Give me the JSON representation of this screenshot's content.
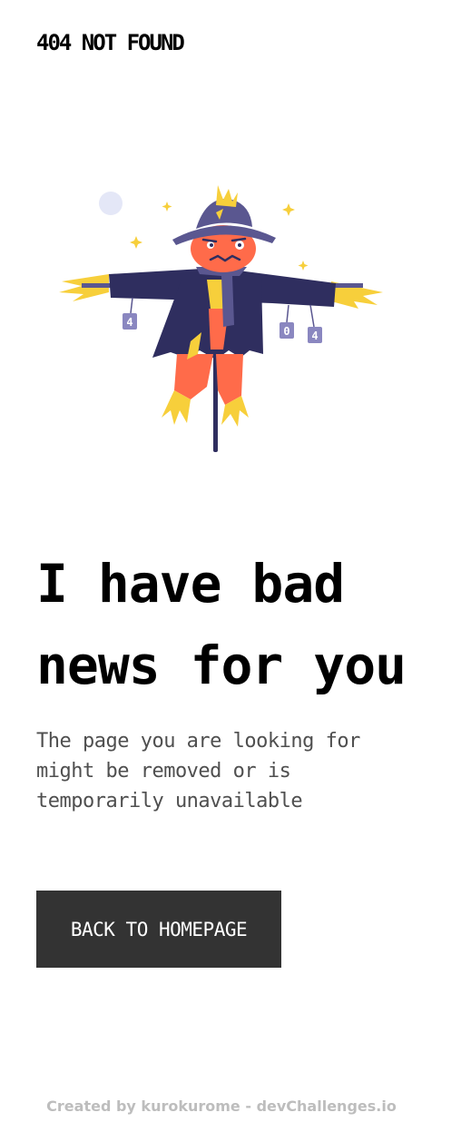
{
  "header": {
    "brand": "404 NOT FOUND"
  },
  "illustration": {
    "name": "scarecrow",
    "left_can_label": "4",
    "right_can_labels": [
      "0",
      "4"
    ]
  },
  "main": {
    "headline": "I have bad news for you",
    "message": "The page you are looking for might be removed or is temporarily unavailable",
    "button_label": "BACK TO HOMEPAGE"
  },
  "footer": {
    "prefix": "Created by ",
    "author": "kurokurome",
    "separator": " - ",
    "site": "devChallenges.io"
  },
  "colors": {
    "button_bg": "#333333",
    "button_text": "#ffffff",
    "message_text": "#4f4f4f",
    "footer_text": "#bdbdbd",
    "coat": "#2f2e5f",
    "hat": "#5a5790",
    "pumpkin": "#ff6b4a",
    "straw": "#f7cf3b"
  }
}
